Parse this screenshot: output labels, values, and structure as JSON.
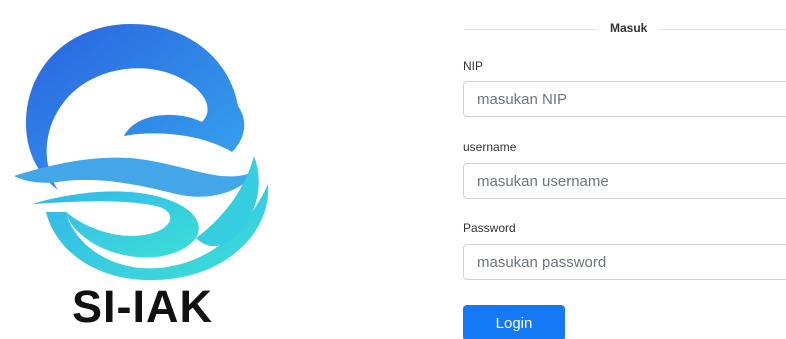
{
  "logo": {
    "icon": "si-hak-swirl-logo",
    "text": "SI-IAK",
    "colors": {
      "blue": "#2f74e6",
      "cyan": "#38d6d6",
      "text": "#111111"
    }
  },
  "form": {
    "title": "Masuk",
    "fields": [
      {
        "label": "NIP",
        "placeholder": "masukan NIP",
        "value": ""
      },
      {
        "label": "username",
        "placeholder": "masukan username",
        "value": ""
      },
      {
        "label": "Password",
        "placeholder": "masukan password",
        "value": ""
      }
    ],
    "submit_label": "Login",
    "accent_color": "#1479f5"
  }
}
